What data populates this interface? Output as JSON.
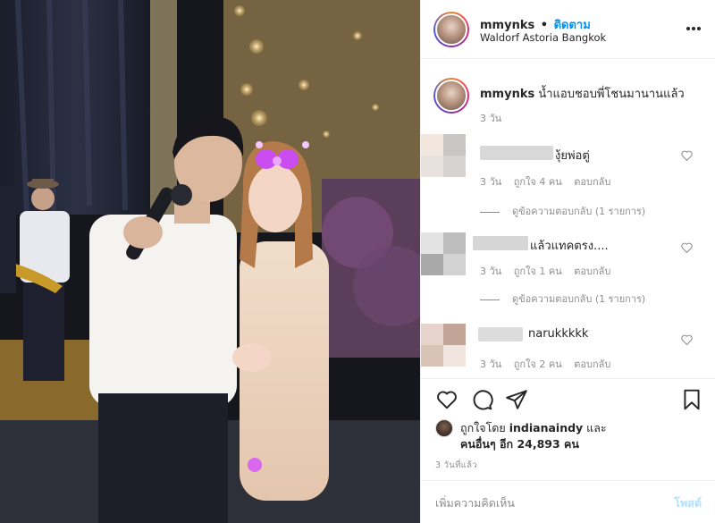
{
  "post": {
    "username": "mmynks",
    "separator": "•",
    "follow_label": "ติดตาม",
    "location": "Waldorf Astoria Bangkok",
    "more_icon": "more-horizontal-icon"
  },
  "caption": {
    "username": "mmynks",
    "text": "น้ำแอบชอบพี่โชนมานานแล้ว",
    "time": "3 วัน"
  },
  "comments": [
    {
      "text": "งุ้ยพ่อตู่",
      "time": "3 วัน",
      "likes": "ถูกใจ 4 คน",
      "reply_label": "ตอบกลับ",
      "view_replies": "ดูข้อความตอบกลับ (1 รายการ)"
    },
    {
      "text": "แล้วแทคตรง....",
      "time": "3 วัน",
      "likes": "ถูกใจ 1 คน",
      "reply_label": "ตอบกลับ",
      "view_replies": "ดูข้อความตอบกลับ (1 รายการ)"
    },
    {
      "text": "narukkkkk",
      "time": "3 วัน",
      "likes": "ถูกใจ 2 คน",
      "reply_label": "ตอบกลับ"
    }
  ],
  "likes": {
    "prefix": "ถูกใจโดย",
    "user": "indianaindy",
    "and": "และ",
    "others": "คนอื่นๆ อีก 24,893 คน"
  },
  "post_time": "3 วันที่แล้ว",
  "add_comment": {
    "placeholder": "เพิ่มความคิดเห็น",
    "post_label": "โพสต์"
  },
  "colors": {
    "accent": "#0095f6",
    "post_disabled": "#b2dffc",
    "muted": "#8e8e8e"
  }
}
